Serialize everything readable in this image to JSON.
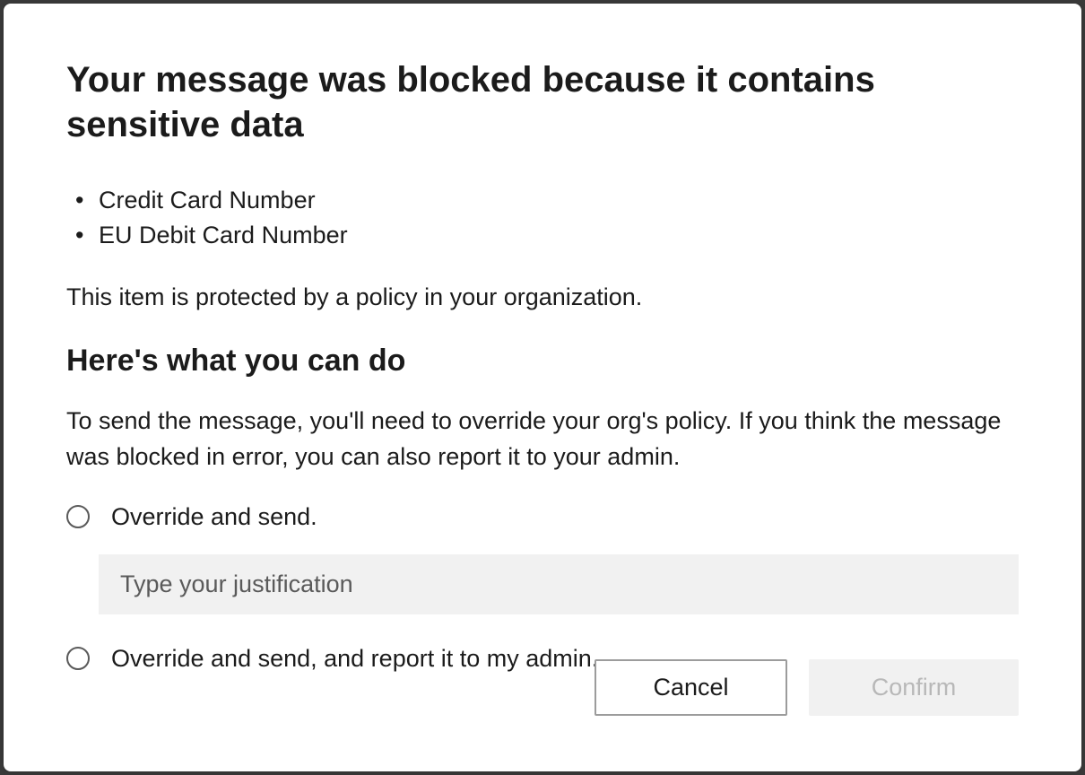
{
  "dialog": {
    "title": "Your message was blocked because it contains sensitive data",
    "sensitive_items": [
      "Credit Card Number",
      "EU Debit Card Number"
    ],
    "policy_text": "This item is protected by a policy in your organization.",
    "subheading": "Here's what you can do",
    "instruction_text": "To send the message, you'll need to override your org's policy. If you think the message was blocked in error, you can also report it to your admin.",
    "options": {
      "override_send": "Override and send.",
      "override_send_report": "Override and send, and report it to my admin."
    },
    "justification_placeholder": "Type your justification",
    "buttons": {
      "cancel": "Cancel",
      "confirm": "Confirm"
    }
  }
}
